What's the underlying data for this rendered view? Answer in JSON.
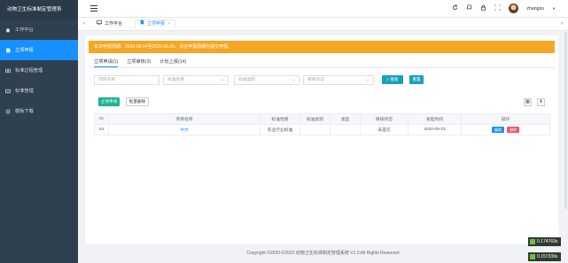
{
  "app": {
    "title": "动物卫生标准制定管理系"
  },
  "sidebar": {
    "items": [
      {
        "label": "工作平台",
        "icon": "home-icon",
        "active": false
      },
      {
        "label": "立项申报",
        "icon": "file-icon",
        "active": true
      },
      {
        "label": "标准过程管理",
        "icon": "list-icon",
        "active": false
      },
      {
        "label": "标准管理",
        "icon": "list-icon",
        "active": false
      },
      {
        "label": "模板下载",
        "icon": "gear-icon",
        "active": false
      }
    ]
  },
  "header": {
    "user": "zhangxu"
  },
  "tabs": [
    {
      "label": "工作平台"
    },
    {
      "label": "立项申报"
    }
  ],
  "notice": "本次申报周期：2020-09-14至2020-09-25，请在申报周期内提交申报。",
  "subtabs": [
    "立项申请(1)",
    "立项审核(3)",
    "计划上报(14)"
  ],
  "filters": {
    "project_name": "项目名称",
    "standard_nature": "标准性质",
    "standard_category": "标准类别",
    "review_status": "审核状态"
  },
  "buttons": {
    "search": "搜索",
    "reset": "重置",
    "add": "立项申请",
    "delete": "批量删除"
  },
  "table": {
    "columns": [
      "ID",
      "项目名称",
      "标准性质",
      "标准类别",
      "类型",
      "审核状态",
      "发起时间",
      "操作"
    ],
    "rows": [
      {
        "id": "54",
        "name": "中文",
        "nature": "农业行业标准",
        "category": "",
        "type": "",
        "status": "未提交",
        "date": "2020-09-23",
        "edit": "编辑",
        "del": "删除"
      }
    ]
  },
  "footer": "Copyright ©2020-©2022 动物卫生标准制定管理系统 V1.0 All Rights Reserved",
  "timers": [
    "0.174769s",
    "0.157339s"
  ]
}
